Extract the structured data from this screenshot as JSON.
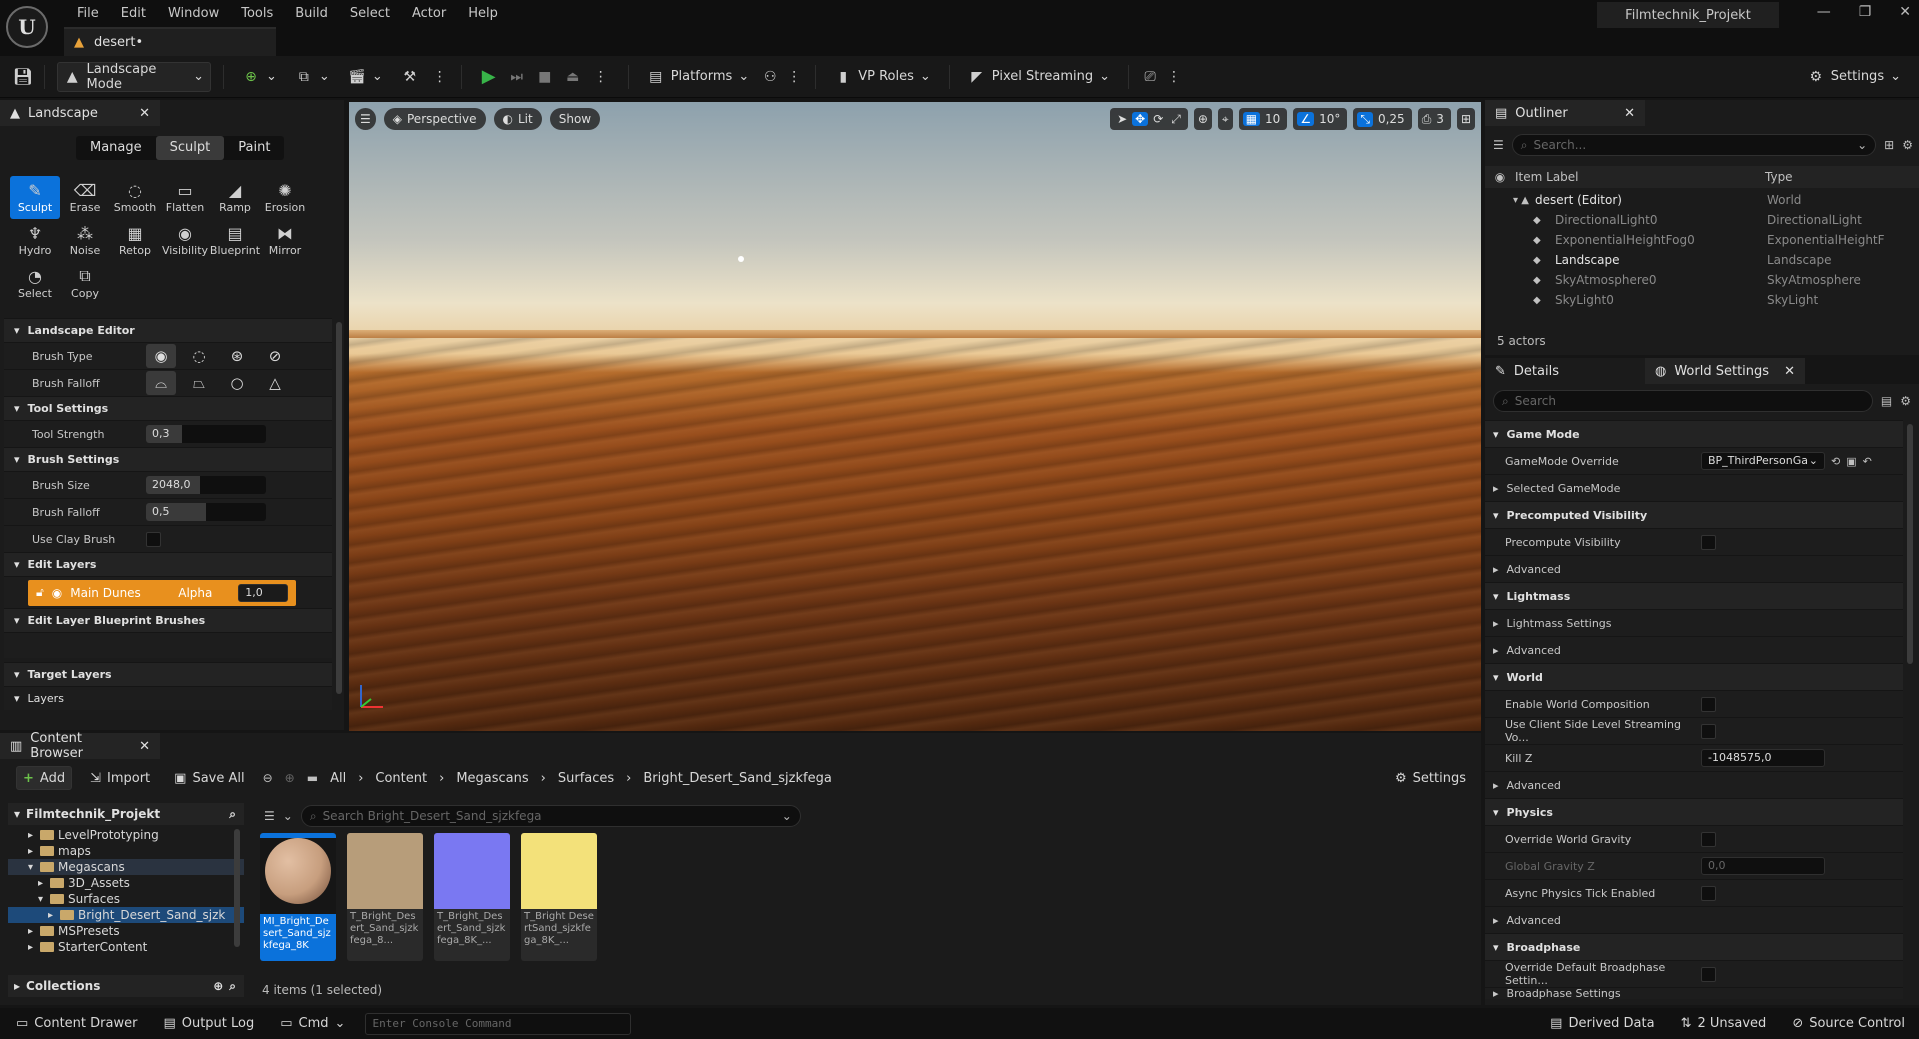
{
  "menubar": {
    "logo": "U",
    "menus": [
      "File",
      "Edit",
      "Window",
      "Tools",
      "Build",
      "Select",
      "Actor",
      "Help"
    ],
    "project_name": "Filmtechnik_Projekt",
    "document_tab": "desert•"
  },
  "toolbar": {
    "mode": "Landscape Mode",
    "platforms": "Platforms",
    "vp_roles": "VP Roles",
    "pixel_streaming": "Pixel Streaming",
    "settings": "Settings"
  },
  "landscape": {
    "tab": "Landscape",
    "modes": [
      "Manage",
      "Sculpt",
      "Paint"
    ],
    "active_mode": "Sculpt",
    "tools": [
      {
        "label": "Sculpt",
        "icon": "brush-icon",
        "glyph": "✎",
        "selected": true
      },
      {
        "label": "Erase",
        "icon": "eraser-icon",
        "glyph": "⌫",
        "selected": false
      },
      {
        "label": "Smooth",
        "icon": "smooth-icon",
        "glyph": "◌",
        "selected": false
      },
      {
        "label": "Flatten",
        "icon": "flatten-icon",
        "glyph": "▭",
        "selected": false
      },
      {
        "label": "Ramp",
        "icon": "ramp-icon",
        "glyph": "◢",
        "selected": false
      },
      {
        "label": "Erosion",
        "icon": "erosion-icon",
        "glyph": "✺",
        "selected": false
      },
      {
        "label": "Hydro",
        "icon": "hydro-icon",
        "glyph": "♆",
        "selected": false
      },
      {
        "label": "Noise",
        "icon": "noise-icon",
        "glyph": "⁂",
        "selected": false
      },
      {
        "label": "Retop",
        "icon": "retopo-icon",
        "glyph": "▦",
        "selected": false
      },
      {
        "label": "Visibility",
        "icon": "visibility-icon",
        "glyph": "◉",
        "selected": false
      },
      {
        "label": "Blueprint",
        "icon": "blueprint-icon",
        "glyph": "▤",
        "selected": false
      },
      {
        "label": "Mirror",
        "icon": "mirror-icon",
        "glyph": "⧓",
        "selected": false
      },
      {
        "label": "Select",
        "icon": "select-icon",
        "glyph": "◔",
        "selected": false
      },
      {
        "label": "Copy",
        "icon": "copy-icon",
        "glyph": "⧉",
        "selected": false
      }
    ],
    "sections": {
      "landscape_editor": "Landscape Editor",
      "tool_settings": "Tool Settings",
      "brush_settings": "Brush Settings",
      "edit_layers": "Edit Layers",
      "edit_layer_bp": "Edit Layer Blueprint Brushes",
      "target_layers": "Target Layers",
      "layers": "Layers"
    },
    "brush_type_label": "Brush Type",
    "brush_falloff_label": "Brush Falloff",
    "tool_strength_label": "Tool Strength",
    "tool_strength": "0,3",
    "tool_strength_fraction": 0.3,
    "brush_size_label": "Brush Size",
    "brush_size": "2048,0",
    "brush_size_fraction": 0.45,
    "brush_falloff2_label": "Brush Falloff",
    "brush_falloff2": "0,5",
    "brush_falloff2_fraction": 0.5,
    "clay_label": "Use Clay Brush",
    "layer_name": "Main Dunes",
    "layer_alpha_label": "Alpha",
    "layer_alpha": "1,0"
  },
  "viewport": {
    "perspective": "Perspective",
    "lit": "Lit",
    "show": "Show",
    "grid_snap": "10",
    "rot_snap": "10°",
    "scale_snap": "0,25",
    "camera_speed": "3"
  },
  "outliner": {
    "tab": "Outliner",
    "search_placeholder": "Search...",
    "col_label": "Item Label",
    "col_type": "Type",
    "rows": [
      {
        "label": "desert (Editor)",
        "type": "World",
        "indent": 0
      },
      {
        "label": "DirectionalLight0",
        "type": "DirectionalLight",
        "indent": 1
      },
      {
        "label": "ExponentialHeightFog0",
        "type": "ExponentialHeightF",
        "indent": 1
      },
      {
        "label": "Landscape",
        "type": "Landscape",
        "indent": 1
      },
      {
        "label": "SkyAtmosphere0",
        "type": "SkyAtmosphere",
        "indent": 1
      },
      {
        "label": "SkyLight0",
        "type": "SkyLight",
        "indent": 1
      }
    ],
    "actor_count": "5 actors"
  },
  "details": {
    "tab_details": "Details",
    "tab_world": "World Settings",
    "search_placeholder": "Search",
    "game_mode": "Game Mode",
    "gamemode_override_label": "GameMode Override",
    "gamemode_override": "BP_ThirdPersonGa",
    "selected_gamemode": "Selected GameMode",
    "precomputed_visibility": "Precomputed Visibility",
    "precompute_visibility": "Precompute Visibility",
    "advanced": "Advanced",
    "lightmass": "Lightmass",
    "lightmass_settings": "Lightmass Settings",
    "world": "World",
    "enable_world_composition": "Enable World Composition",
    "client_side_streaming": "Use Client Side Level Streaming Vo...",
    "kill_z_label": "Kill Z",
    "kill_z": "-1048575,0",
    "physics": "Physics",
    "override_world_gravity": "Override World Gravity",
    "global_gravity_label": "Global Gravity Z",
    "global_gravity": "0,0",
    "async_physics": "Async Physics Tick Enabled",
    "broadphase": "Broadphase",
    "override_broadphase": "Override Default Broadphase Settin...",
    "broadphase_settings": "Broadphase Settings"
  },
  "content_browser": {
    "tab": "Content Browser",
    "add": "Add",
    "import": "Import",
    "save_all": "Save All",
    "breadcrumb": [
      "All",
      "Content",
      "Megascans",
      "Surfaces",
      "Bright_Desert_Sand_sjzkfega"
    ],
    "settings": "Settings",
    "root": "Filmtechnik_Projekt",
    "tree": [
      {
        "label": "LevelPrototyping",
        "depth": 1,
        "open": false
      },
      {
        "label": "maps",
        "depth": 1,
        "open": false
      },
      {
        "label": "Megascans",
        "depth": 1,
        "open": true
      },
      {
        "label": "3D_Assets",
        "depth": 2,
        "open": false
      },
      {
        "label": "Surfaces",
        "depth": 2,
        "open": true
      },
      {
        "label": "Bright_Desert_Sand_sjzk",
        "depth": 3,
        "open": false
      },
      {
        "label": "MSPresets",
        "depth": 1,
        "open": false
      },
      {
        "label": "StarterContent",
        "depth": 1,
        "open": false
      }
    ],
    "collections": "Collections",
    "search_placeholder": "Search Bright_Desert_Sand_sjzkfega",
    "assets": [
      {
        "label": "MI_Bright_Desert_Sand_sjzkfega_8K",
        "color": "#c79e7e",
        "selected": true
      },
      {
        "label": "T_Bright_Desert_Sand_sjzkfega_8...",
        "color": "#b79d7a",
        "selected": false
      },
      {
        "label": "T_Bright_Desert_Sand_sjzkfega_8K_...",
        "color": "#7a78f2",
        "selected": false
      },
      {
        "label": "T_Bright DesertSand_sjzkfega_8K_...",
        "color": "#f3e17a",
        "selected": false
      }
    ],
    "item_count": "4 items (1 selected)"
  },
  "statusbar": {
    "content_drawer": "Content Drawer",
    "output_log": "Output Log",
    "cmd": "Cmd",
    "console_placeholder": "Enter Console Command",
    "derived_data": "Derived Data",
    "unsaved": "2 Unsaved",
    "source_control": "Source Control"
  },
  "colors": {
    "accent": "#0b72db",
    "layer_orange": "#e8901e",
    "play_green": "#38b449"
  }
}
